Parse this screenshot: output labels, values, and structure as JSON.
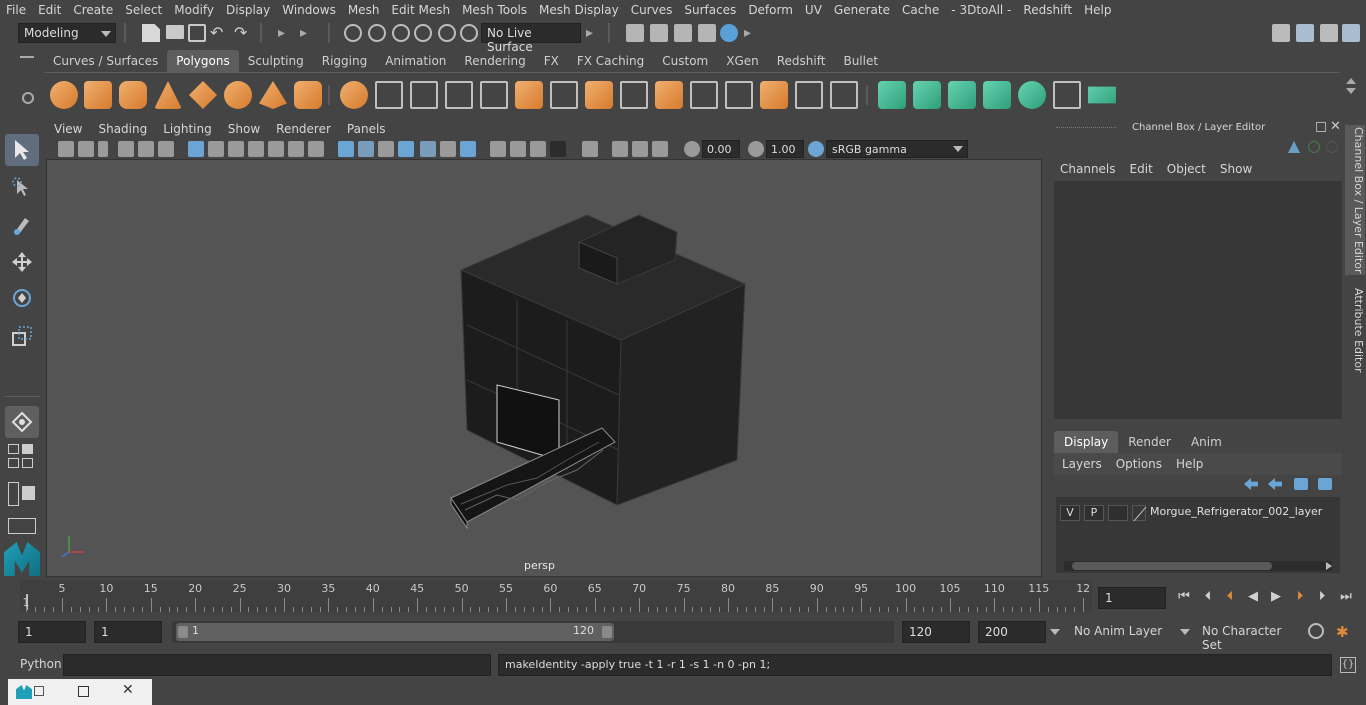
{
  "menubar": [
    "File",
    "Edit",
    "Create",
    "Select",
    "Modify",
    "Display",
    "Windows",
    "Mesh",
    "Edit Mesh",
    "Mesh Tools",
    "Mesh Display",
    "Curves",
    "Surfaces",
    "Deform",
    "UV",
    "Generate",
    "Cache",
    "- 3DtoAll -",
    "Redshift",
    "Help"
  ],
  "statusline": {
    "mode": "Modeling",
    "live_surface": "No Live Surface"
  },
  "shelf_tabs": [
    "Curves / Surfaces",
    "Polygons",
    "Sculpting",
    "Rigging",
    "Animation",
    "Rendering",
    "FX",
    "FX Caching",
    "Custom",
    "XGen",
    "Redshift",
    "Bullet"
  ],
  "viewport": {
    "menu": [
      "View",
      "Shading",
      "Lighting",
      "Show",
      "Renderer",
      "Panels"
    ],
    "exposure": "0.00",
    "gamma": "1.00",
    "color_space": "sRGB gamma",
    "camera_label": "persp"
  },
  "channel_box": {
    "title": "Channel Box / Layer Editor",
    "menu": [
      "Channels",
      "Edit",
      "Object",
      "Show"
    ],
    "layer_tabs": [
      "Display",
      "Render",
      "Anim"
    ],
    "layer_menu": [
      "Layers",
      "Options",
      "Help"
    ],
    "layer": {
      "v": "V",
      "p": "P",
      "name": "Morgue_Refrigerator_002_layer"
    }
  },
  "side_tabs": [
    "Channel Box / Layer Editor",
    "Attribute Editor"
  ],
  "timeline": {
    "ticks": [
      "5",
      "10",
      "15",
      "20",
      "25",
      "30",
      "35",
      "40",
      "45",
      "50",
      "55",
      "60",
      "65",
      "70",
      "75",
      "80",
      "85",
      "90",
      "95",
      "100",
      "105",
      "110",
      "115",
      "12"
    ],
    "start_marker": "1",
    "current_frame": "1"
  },
  "range": {
    "start": "1",
    "anim_start": "1",
    "slider_start": "1",
    "slider_end": "120",
    "end": "120",
    "anim_end": "200",
    "anim_layer": "No Anim Layer",
    "character_set": "No Character Set"
  },
  "command": {
    "lang": "Python",
    "result": "makeIdentity -apply true -t 1 -r 1 -s 1 -n 0 -pn 1;"
  }
}
